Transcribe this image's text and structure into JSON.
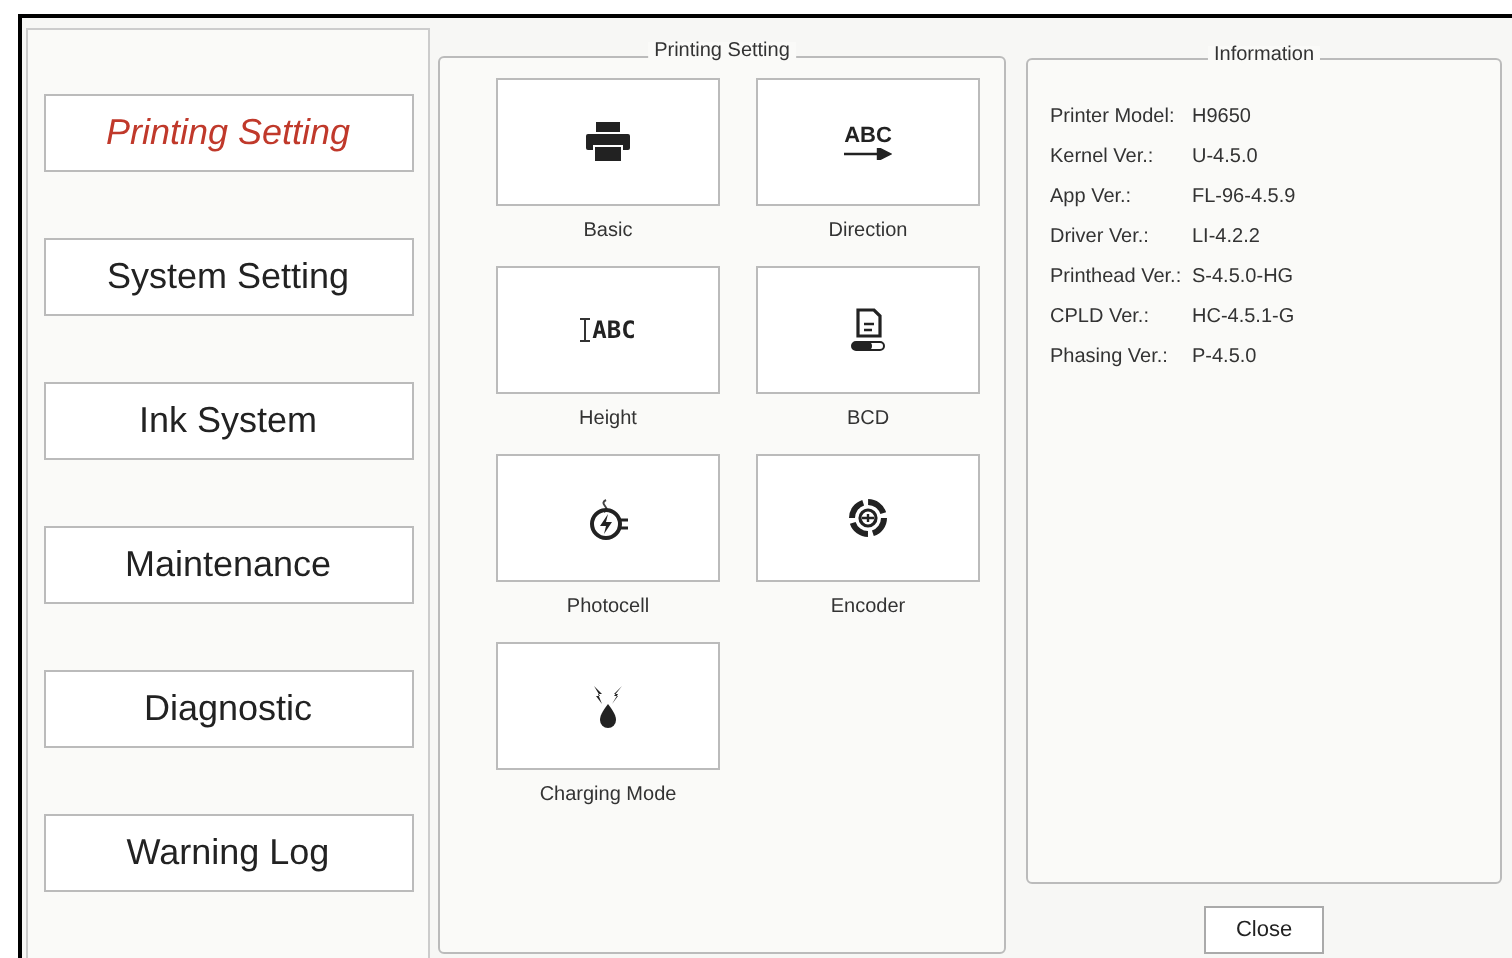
{
  "sidebar": {
    "items": [
      {
        "label": "Printing Setting",
        "selected": true
      },
      {
        "label": "System Setting",
        "selected": false
      },
      {
        "label": "Ink System",
        "selected": false
      },
      {
        "label": "Maintenance",
        "selected": false
      },
      {
        "label": "Diagnostic",
        "selected": false
      },
      {
        "label": "Warning Log",
        "selected": false
      }
    ]
  },
  "printing_setting": {
    "title": "Printing Setting",
    "tile_rows": [
      {
        "tiles": [
          {
            "kind": "printer",
            "label": "Basic"
          },
          {
            "kind": "direction",
            "glyph": "ABC",
            "label": "Direction"
          }
        ]
      },
      {
        "tiles": [
          {
            "kind": "height",
            "glyph": "ABC",
            "label": "Height"
          },
          {
            "kind": "bcd",
            "label": "BCD"
          }
        ]
      },
      {
        "tiles": [
          {
            "kind": "photocell",
            "label": "Photocell"
          },
          {
            "kind": "encoder",
            "label": "Encoder"
          }
        ]
      },
      {
        "tiles": [
          {
            "kind": "charging",
            "label": "Charging Mode"
          }
        ]
      }
    ]
  },
  "information": {
    "title": "Information",
    "rows": [
      {
        "label": "Printer Model:",
        "value": "H9650"
      },
      {
        "label": "Kernel Ver.:",
        "value": "U-4.5.0"
      },
      {
        "label": "App Ver.:",
        "value": "FL-96-4.5.9"
      },
      {
        "label": "Driver Ver.:",
        "value": "LI-4.2.2"
      },
      {
        "label": "Printhead Ver.:",
        "value": "S-4.5.0-HG"
      },
      {
        "label": "CPLD Ver.:",
        "value": "HC-4.5.1-G"
      },
      {
        "label": "Phasing Ver.:",
        "value": "P-4.5.0"
      }
    ]
  },
  "close_button": "Close"
}
